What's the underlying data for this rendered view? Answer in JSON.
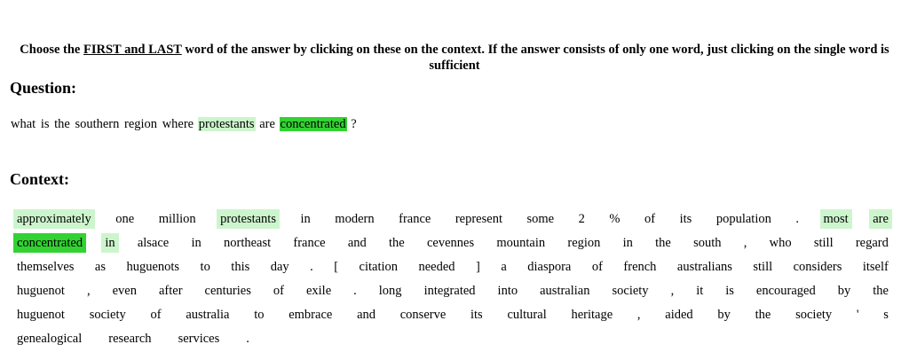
{
  "instruction": {
    "prefix": "Choose the ",
    "underlined": "FIRST and LAST",
    "suffix": " word of the answer by clicking on these on the context. If the answer consists of only one word, just clicking on the single word is sufficient"
  },
  "question_heading": "Question:",
  "question_tokens": [
    "what",
    "is",
    "the",
    "southern",
    "region",
    "where",
    "protestants",
    "are",
    "concentrated",
    "?"
  ],
  "context_heading": "Context:",
  "context_lines": [
    [
      "approximately",
      "one",
      "million",
      "protestants",
      "in",
      "modern",
      "france",
      "represent",
      "some",
      "2",
      "%",
      "of",
      "its",
      "population",
      ".",
      "most",
      "are"
    ],
    [
      "concentrated",
      "in",
      "alsace",
      "in",
      "northeast",
      "france",
      "and",
      "the",
      "cevennes",
      "mountain",
      "region",
      "in",
      "the",
      "south",
      ",",
      "who",
      "still",
      "regard"
    ],
    [
      "themselves",
      "as",
      "huguenots",
      "to",
      "this",
      "day",
      ".",
      "[",
      "citation",
      "needed",
      "]",
      "a",
      "diaspora",
      "of",
      "french",
      "australians",
      "still",
      "considers",
      "itself"
    ],
    [
      "huguenot",
      ",",
      "even",
      "after",
      "centuries",
      "of",
      "exile",
      ".",
      "long",
      "integrated",
      "into",
      "australian",
      "society",
      ",",
      "it",
      "is",
      "encouraged",
      "by",
      "the"
    ],
    [
      "huguenot",
      "society",
      "of",
      "australia",
      "to",
      "embrace",
      "and",
      "conserve",
      "its",
      "cultural",
      "heritage",
      ",",
      "aided",
      "by",
      "the",
      "society",
      "'",
      "s"
    ],
    [
      "genealogical",
      "research",
      "services",
      "."
    ]
  ],
  "highlights": {
    "question_light": [
      6
    ],
    "question_strong": [
      8
    ],
    "context_light": [
      "0-0",
      "0-3",
      "0-15",
      "0-16",
      "1-1"
    ],
    "context_strong": [
      "1-0"
    ]
  },
  "colors": {
    "highlight_light": "#cdf5cd",
    "highlight_strong": "#33d233"
  }
}
